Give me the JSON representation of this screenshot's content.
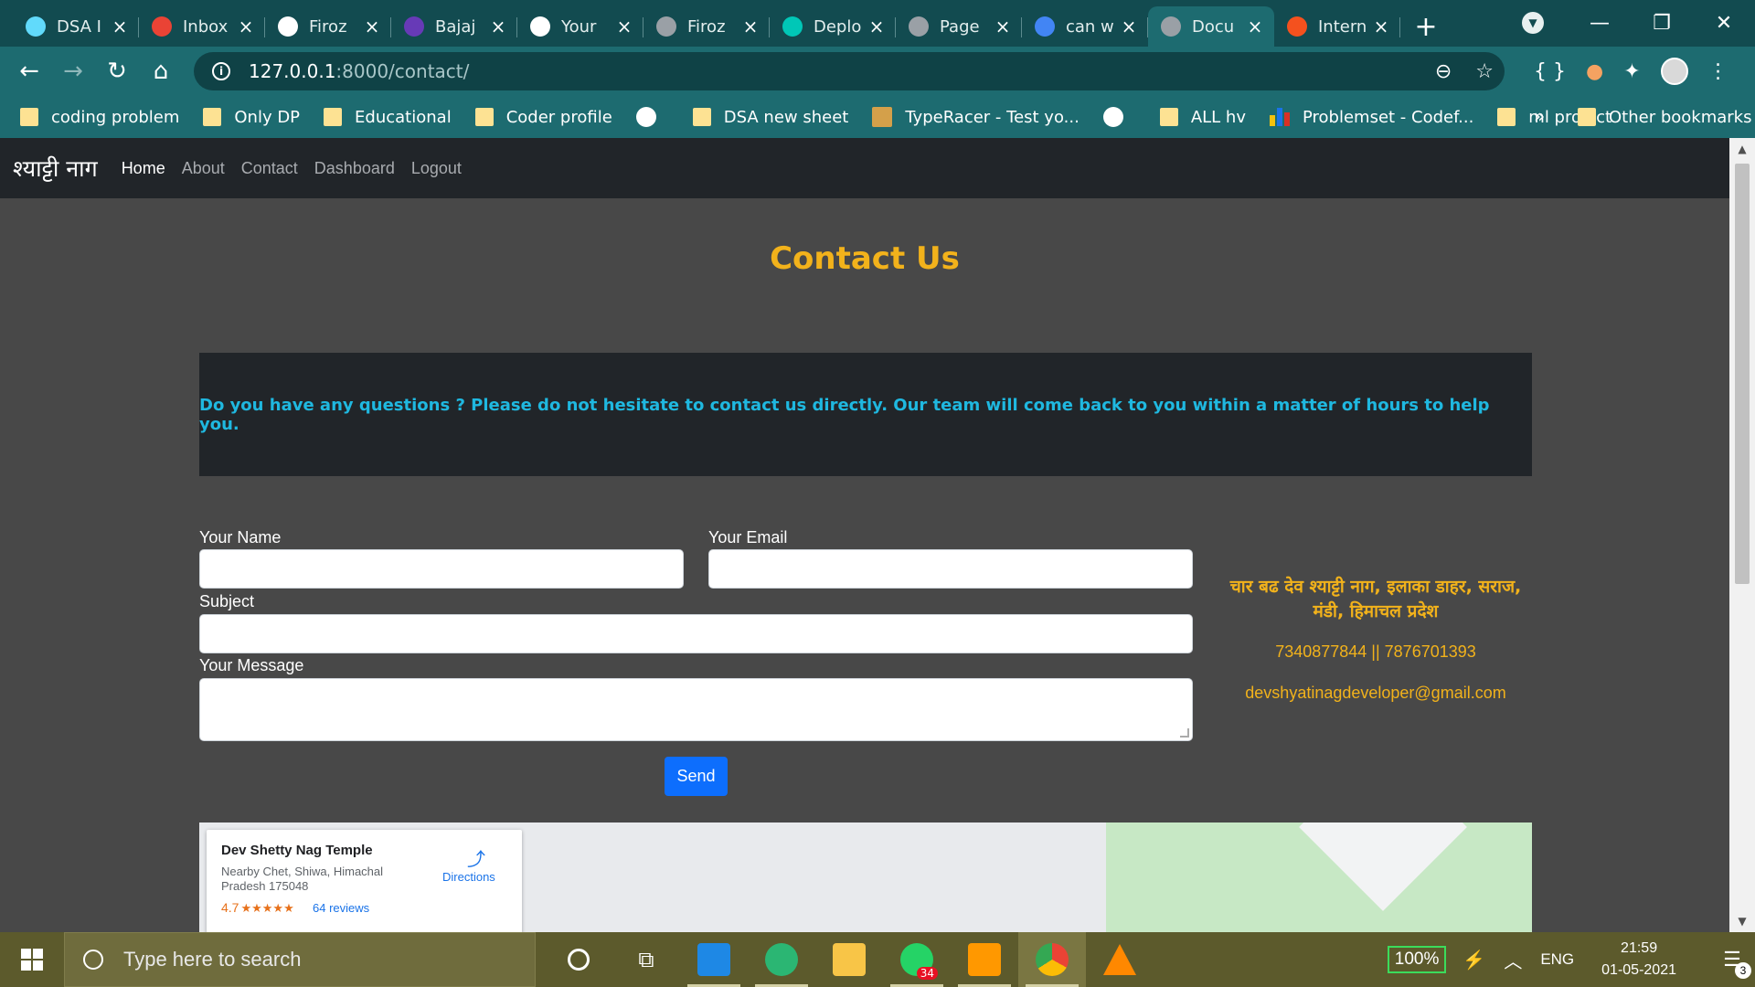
{
  "browser": {
    "tabs": [
      {
        "title": "DSA I",
        "icon": "react-icon",
        "color": "#61dafb"
      },
      {
        "title": "Inbox",
        "icon": "gmail-icon",
        "color": "#ea4335"
      },
      {
        "title": "Firoz",
        "icon": "github-icon",
        "color": "#ffffff"
      },
      {
        "title": "Bajaj",
        "icon": "forms-icon",
        "color": "#673ab7"
      },
      {
        "title": "Your",
        "icon": "github-icon",
        "color": "#ffffff"
      },
      {
        "title": "Firoz",
        "icon": "globe-icon",
        "color": "#9aa0a6"
      },
      {
        "title": "Deplo",
        "icon": "netlify-icon",
        "color": "#00c7b7"
      },
      {
        "title": "Page",
        "icon": "globe-icon",
        "color": "#9aa0a6"
      },
      {
        "title": "can w",
        "icon": "google-icon",
        "color": "#4285f4"
      },
      {
        "title": "Docu",
        "icon": "globe-icon",
        "color": "#9aa0a6"
      },
      {
        "title": "Intern",
        "icon": "site-icon",
        "color": "#f4511e"
      }
    ],
    "active_tab": 9,
    "url_host": "127.0.0.1",
    "url_rest": ":8000/contact/",
    "bookmarks": [
      {
        "label": "coding problem",
        "icon": "folder"
      },
      {
        "label": "Only DP",
        "icon": "folder"
      },
      {
        "label": "Educational",
        "icon": "folder"
      },
      {
        "label": "Coder profile",
        "icon": "folder"
      },
      {
        "label": "",
        "icon": "globe"
      },
      {
        "label": "DSA new sheet",
        "icon": "folder"
      },
      {
        "label": "TypeRacer - Test yo...",
        "icon": "typeracer"
      },
      {
        "label": "",
        "icon": "globe"
      },
      {
        "label": "ALL hv",
        "icon": "folder"
      },
      {
        "label": "Problemset - Codef...",
        "icon": "codeforces"
      },
      {
        "label": "ml project",
        "icon": "folder"
      }
    ],
    "bookmarks_more": "»",
    "other_bookmarks": "Other bookmarks"
  },
  "site": {
    "brand": "श्याट्टी नाग",
    "nav": [
      "Home",
      "About",
      "Contact",
      "Dashboard",
      "Logout"
    ],
    "active_nav": 0
  },
  "page": {
    "title": "Contact Us",
    "intro": "Do you have any questions ? Please do not hesitate to contact us directly. Our team will come back to you within a matter of hours to help you.",
    "form": {
      "name_label": "Your Name",
      "email_label": "Your Email",
      "subject_label": "Subject",
      "message_label": "Your Message",
      "name_value": "",
      "email_value": "",
      "subject_value": "",
      "message_value": "",
      "send_label": "Send"
    },
    "address": "चार बढ देव श्याट्टी नाग, इलाका डाहर, सराज, मंडी, हिमाचल प्रदेश",
    "phones": "7340877844 || 7876701393",
    "email": "devshyatinagdeveloper@gmail.com"
  },
  "map_card": {
    "title": "Dev Shetty Nag Temple",
    "address": "Nearby Chet, Shiwa, Himachal Pradesh 175048",
    "rating": "4.7",
    "stars": "★★★★★",
    "reviews": "64 reviews",
    "directions": "Directions"
  },
  "taskbar": {
    "search_placeholder": "Type here to search",
    "whatsapp_badge": "34",
    "battery": "100%",
    "language": "ENG",
    "time": "21:59",
    "date": "01-05-2021",
    "notifications": "3"
  },
  "colors": {
    "accent": "#f2b21b",
    "intro_text": "#1fb8e0",
    "send_button": "#0d6efd",
    "navbar": "#212529"
  }
}
